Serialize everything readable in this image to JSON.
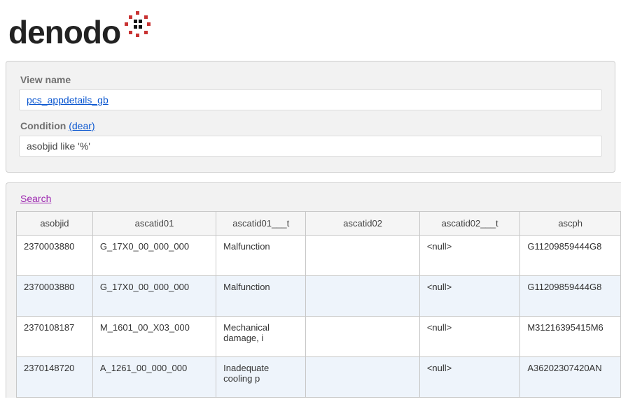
{
  "logo": {
    "text": "denodo"
  },
  "form": {
    "view_name_label": "View name",
    "view_name_value": "pcs_appdetails_gb",
    "condition_label": "Condition",
    "condition_clear": "(dear)",
    "condition_value": "asobjid like '%'"
  },
  "search": {
    "label": "Search"
  },
  "table": {
    "columns": [
      "asobjid",
      "ascatid01",
      "ascatid01___t",
      "ascatid02",
      "ascatid02___t",
      "ascph"
    ],
    "rows": [
      {
        "asobjid": "2370003880",
        "ascatid01": "G_17X0_00_000_000",
        "ascatid01___t": "Malfunction",
        "ascatid02": "",
        "ascatid02___t": "<null>",
        "ascph": "G11209859444G8"
      },
      {
        "asobjid": "2370003880",
        "ascatid01": "G_17X0_00_000_000",
        "ascatid01___t": "Malfunction",
        "ascatid02": "",
        "ascatid02___t": "<null>",
        "ascph": "G11209859444G8"
      },
      {
        "asobjid": "2370108187",
        "ascatid01": "M_1601_00_X03_000",
        "ascatid01___t": "Mechanical damage, i",
        "ascatid02": "",
        "ascatid02___t": "<null>",
        "ascph": "M31216395415M6"
      },
      {
        "asobjid": "2370148720",
        "ascatid01": "A_1261_00_000_000",
        "ascatid01___t": "Inadequate cooling p",
        "ascatid02": "",
        "ascatid02___t": "<null>",
        "ascph": "A36202307420AN"
      }
    ]
  }
}
